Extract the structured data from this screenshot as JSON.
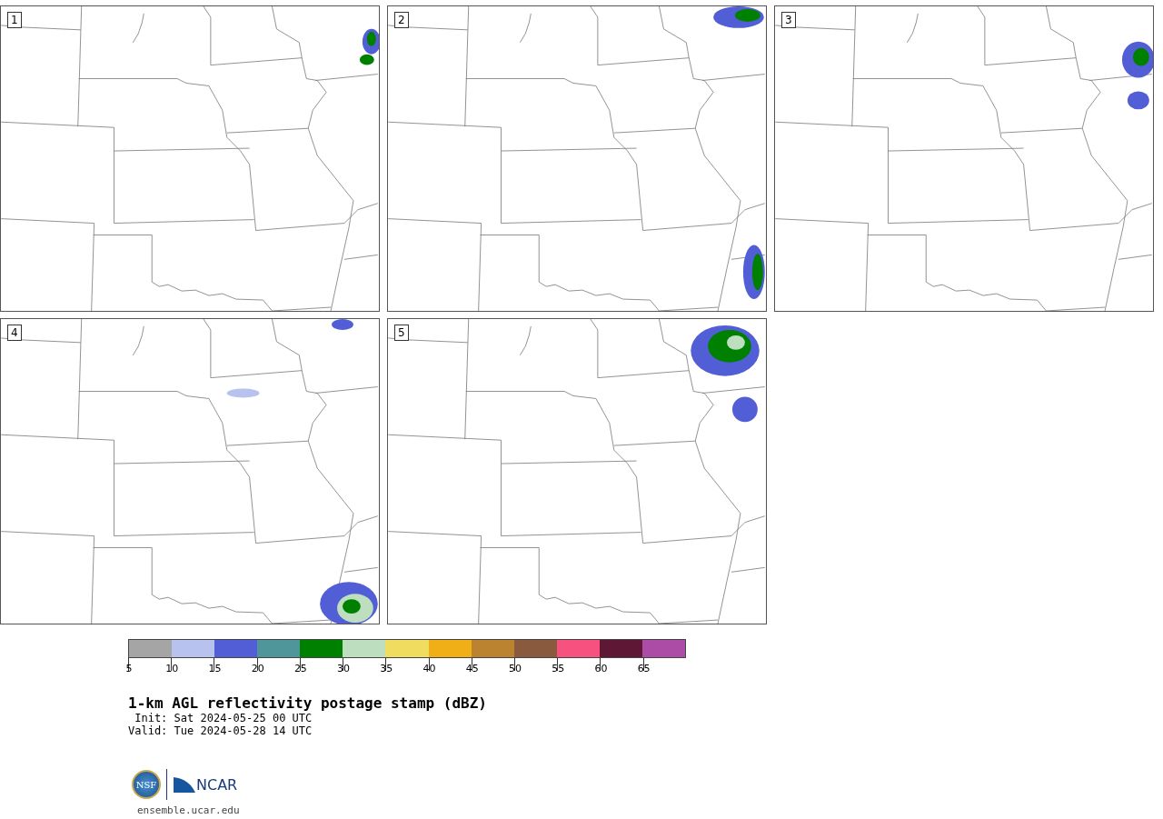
{
  "panels": [
    {
      "label": "1"
    },
    {
      "label": "2"
    },
    {
      "label": "3"
    },
    {
      "label": "4"
    },
    {
      "label": "5"
    }
  ],
  "colorbar": {
    "segments": [
      {
        "color": "#a5a5a5"
      },
      {
        "color": "#b7c3ee"
      },
      {
        "color": "#525ed5"
      },
      {
        "color": "#4f969b"
      },
      {
        "color": "#008000"
      },
      {
        "color": "#bedfbf"
      },
      {
        "color": "#f0dc5e"
      },
      {
        "color": "#f0ae17"
      },
      {
        "color": "#bb832f"
      },
      {
        "color": "#8a5a3f"
      },
      {
        "color": "#f75180"
      },
      {
        "color": "#5f1736"
      },
      {
        "color": "#ac4ca6"
      }
    ],
    "ticks": [
      "5",
      "10",
      "15",
      "20",
      "25",
      "30",
      "35",
      "40",
      "45",
      "50",
      "55",
      "60",
      "65"
    ]
  },
  "title": "1-km AGL reflectivity postage stamp (dBZ)",
  "init": " Init: Sat 2024-05-25 00 UTC",
  "valid": "Valid: Tue 2024-05-28 14 UTC",
  "logo": {
    "left": "NSF",
    "right": "NCAR"
  },
  "footer": "ensemble.ucar.edu"
}
